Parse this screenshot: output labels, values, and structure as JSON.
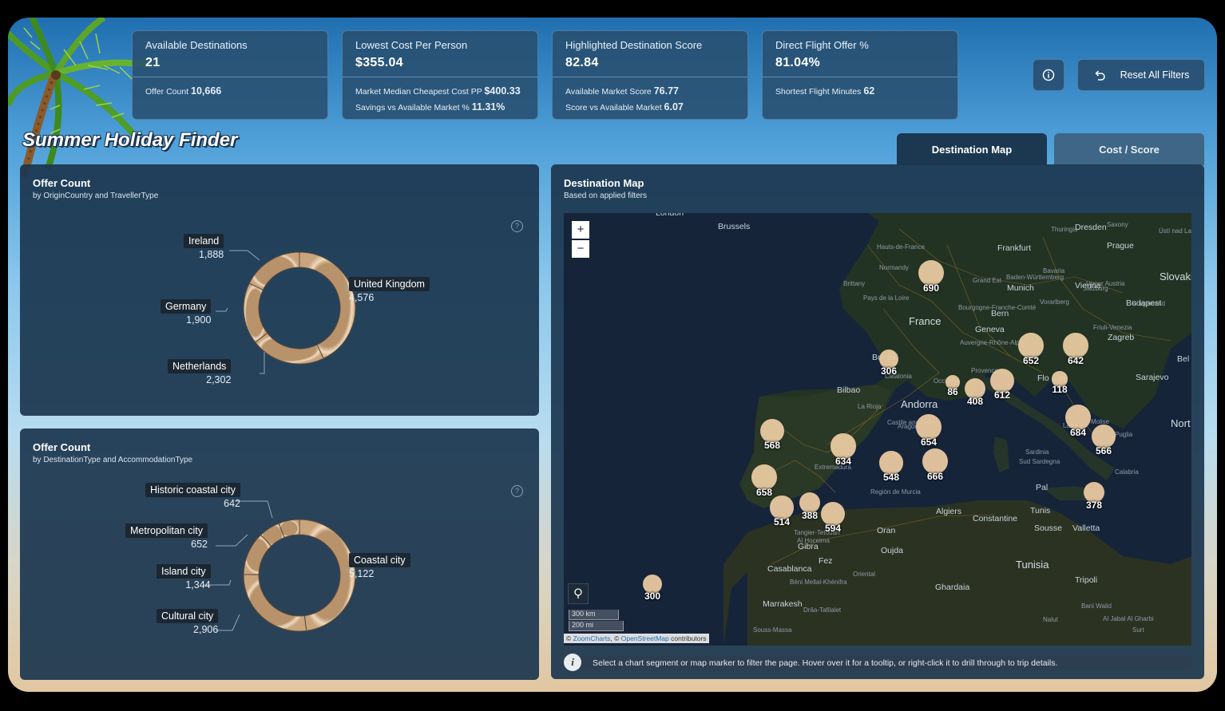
{
  "kpis": [
    {
      "title": "Available Destinations",
      "value": "21",
      "subs": [
        {
          "label": "Offer Count",
          "value": "10,666"
        }
      ]
    },
    {
      "title": "Lowest Cost Per Person",
      "value": "$355.04",
      "subs": [
        {
          "label": "Market Median Cheapest Cost PP",
          "value": "$400.33"
        },
        {
          "label": "Savings vs Available Market %",
          "value": "11.31%"
        }
      ]
    },
    {
      "title": "Highlighted Destination Score",
      "value": "82.84",
      "subs": [
        {
          "label": "Available Market Score",
          "value": "76.77"
        },
        {
          "label": "Score vs Available Market",
          "value": "6.07"
        }
      ]
    },
    {
      "title": "Direct Flight Offer %",
      "value": "81.04%",
      "subs": [
        {
          "label": "Shortest Flight Minutes",
          "value": "62"
        }
      ]
    }
  ],
  "toolbar": {
    "reset_label": "Reset All Filters"
  },
  "app_title": "Summer Holiday Finder",
  "tabs": [
    {
      "label": "Destination Map",
      "active": true
    },
    {
      "label": "Cost / Score",
      "active": false
    }
  ],
  "donut1": {
    "title": "Offer Count",
    "subtitle": "by OriginCountry and TravellerType",
    "slices": [
      {
        "name": "United Kingdom",
        "count": "4,576",
        "value": 4576
      },
      {
        "name": "Netherlands",
        "count": "2,302",
        "value": 2302
      },
      {
        "name": "Germany",
        "count": "1,900",
        "value": 1900
      },
      {
        "name": "Ireland",
        "count": "1,888",
        "value": 1888
      }
    ]
  },
  "donut2": {
    "title": "Offer Count",
    "subtitle": "by DestinationType and AccommodationType",
    "slices": [
      {
        "name": "Coastal city",
        "count": "5,122",
        "value": 5122
      },
      {
        "name": "Cultural city",
        "count": "2,906",
        "value": 2906
      },
      {
        "name": "Island city",
        "count": "1,344",
        "value": 1344
      },
      {
        "name": "Metropolitan city",
        "count": "652",
        "value": 652
      },
      {
        "name": "Historic coastal city",
        "count": "642",
        "value": 642
      }
    ]
  },
  "map": {
    "title": "Destination Map",
    "subtitle": "Based on applied filters",
    "zoom_in": "+",
    "zoom_out": "−",
    "scale_km": "300 km",
    "scale_mi": "200 mi",
    "attribution_pre": "© ",
    "attribution_zoom": "ZoomCharts",
    "attribution_mid": ", © ",
    "attribution_osm": "OpenStreetMap",
    "attribution_post": " contributors",
    "places_big": [
      "France",
      "Andorra",
      "Tunisia",
      "Slovaki",
      "Nort"
    ],
    "places": [
      "London",
      "Brussels",
      "Frankfurt",
      "Prague",
      "Dresden",
      "Munich",
      "Vienna",
      "Budapest",
      "Bern",
      "Geneva",
      "Zagreb",
      "Sarajevo",
      "Bilbao",
      "Algiers",
      "Constantine",
      "Tunis",
      "Sousse",
      "Valletta",
      "Tripoli",
      "Oran",
      "Oujda",
      "Fez",
      "Casablanca",
      "Marrakesh",
      "Ghardaia",
      "Bel",
      "Gibra",
      "Bo",
      "ux",
      "Flo",
      "ce",
      "Pal"
    ],
    "places_small": [
      "Normandy",
      "Brittany",
      "Pays de la Loire",
      "Grand Est",
      "Baden-Württemberg",
      "Bourgogne-Franche-Comté",
      "Vorarlberg",
      "Salzburg",
      "Upper Austria",
      "Burgenland",
      "Friuli-Venezia",
      "Auvergne-Rhône-Alpes",
      "Provence",
      "Occitanie",
      "Sardinia",
      "Sud Sardegna",
      "Molise",
      "Puglia",
      "Calabria",
      "Castile and León",
      "La Rioja",
      "Aragon",
      "Extremadura",
      "Región de Murcia",
      "Tangier-Tetouan",
      "Al Hoceima",
      "Oriental",
      "Béni Mellal-Khénifra",
      "Drâa-Tafilalet",
      "Souss-Massa",
      "Bani Walid",
      "Al Jabal Al Gharbi",
      "Nalut",
      "Surt",
      "Hauts-de-France",
      "Thuringia",
      "Bavaria",
      "Saxony",
      "Ústí nad Labem",
      "Lazio",
      "Catalonia"
    ],
    "bubbles": [
      {
        "label": "690",
        "value": 690
      },
      {
        "label": "306",
        "value": 306
      },
      {
        "label": "652",
        "value": 652
      },
      {
        "label": "642",
        "value": 642
      },
      {
        "label": "86",
        "value": 86
      },
      {
        "label": "408",
        "value": 408
      },
      {
        "label": "612",
        "value": 612
      },
      {
        "label": "118",
        "value": 118
      },
      {
        "label": "568",
        "value": 568
      },
      {
        "label": "654",
        "value": 654
      },
      {
        "label": "634",
        "value": 634
      },
      {
        "label": "684",
        "value": 684
      },
      {
        "label": "566",
        "value": 566
      },
      {
        "label": "548",
        "value": 548
      },
      {
        "label": "666",
        "value": 666
      },
      {
        "label": "658",
        "value": 658
      },
      {
        "label": "388",
        "value": 388
      },
      {
        "label": "514",
        "value": 514
      },
      {
        "label": "594",
        "value": 594
      },
      {
        "label": "378",
        "value": 378
      },
      {
        "label": "300",
        "value": 300
      }
    ]
  },
  "info_text": "Select a chart segment or map marker to filter the page. Hover over it for a tooltip, or right-click it to drill through to trip details.",
  "info_icon": "i",
  "help_icon": "?",
  "colors": {
    "accent": "#e8c9a0",
    "panel": "#1c3750",
    "link": "#4fa3e0"
  }
}
